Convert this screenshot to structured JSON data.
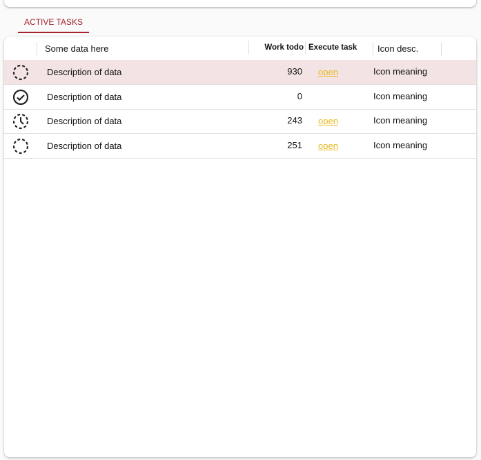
{
  "tab": {
    "label": "ACTIVE TASKS"
  },
  "columns": [
    "Some data here",
    "Work todo",
    "Execute task",
    "Icon desc."
  ],
  "rows": [
    {
      "icon": "pending-dashed-circle-icon",
      "desc": "Description of data",
      "work": "930",
      "action": "open",
      "meaning": "Icon meaning",
      "selected": true
    },
    {
      "icon": "check-circle-icon",
      "desc": "Description of data",
      "work": "0",
      "action": "",
      "meaning": "Icon meaning"
    },
    {
      "icon": "dashed-clock-icon",
      "desc": "Description of data",
      "work": "243",
      "action": "open",
      "meaning": "Icon meaning"
    },
    {
      "icon": "pending-dashed-circle-icon",
      "desc": "Description of data",
      "work": "251",
      "action": "open",
      "meaning": "Icon meaning"
    }
  ],
  "colors": {
    "accent": "#a3222b",
    "link": "#e8b820",
    "selected_row": "#f3e3e4"
  }
}
